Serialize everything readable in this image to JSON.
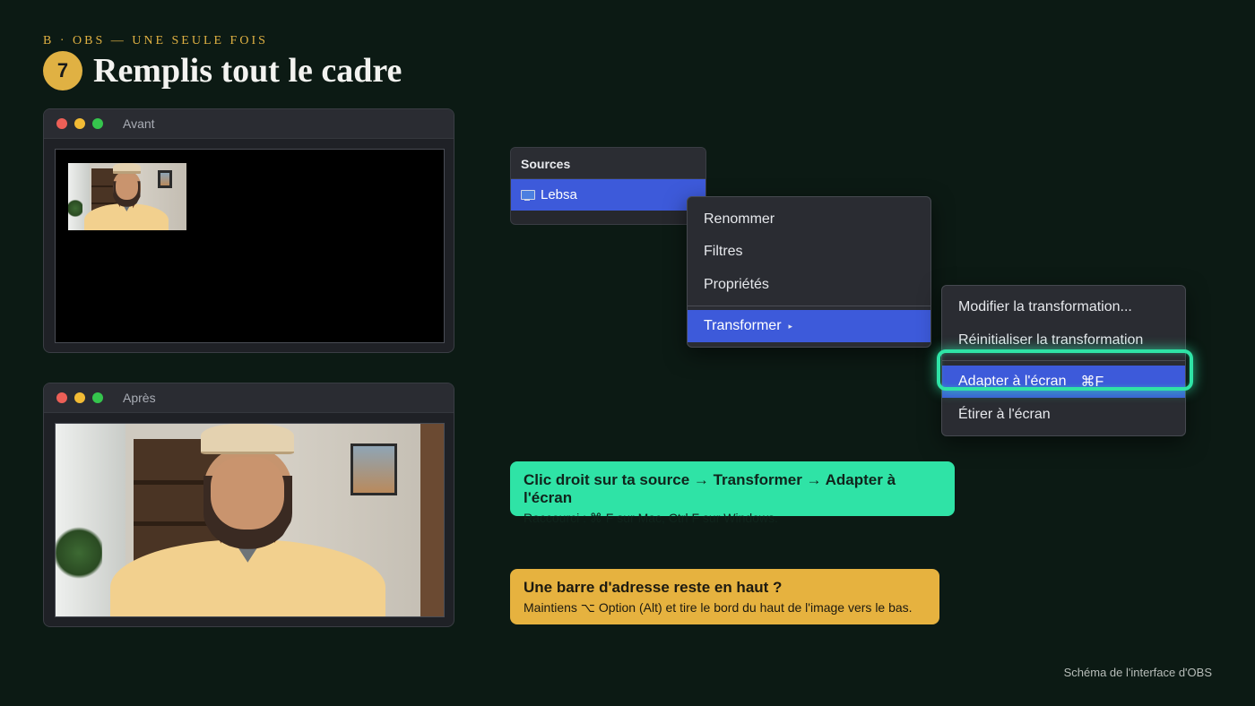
{
  "header": {
    "eyebrow": "B · OBS — UNE SEULE FOIS",
    "step_number": "7",
    "title": "Remplis tout le cadre"
  },
  "windows": {
    "before": {
      "title": "Avant"
    },
    "after": {
      "title": "Après"
    }
  },
  "sources_panel": {
    "heading": "Sources",
    "selected_source": "Lebsa",
    "source_icon": "monitor-icon"
  },
  "context_menu": {
    "items": [
      "Renommer",
      "Filtres",
      "Propriétés",
      "Transformer"
    ],
    "active": "Transformer"
  },
  "transform_submenu": {
    "items": [
      "Modifier la transformation...",
      "Réinitialiser la transformation",
      "Adapter à l'écran",
      "Étirer à l'écran"
    ],
    "active": "Adapter à l'écran",
    "active_shortcut": "⌘F"
  },
  "callouts": {
    "primary": {
      "title": "Clic droit sur ta source → Transformer → Adapter à l'écran",
      "subtitle": "Raccourci : ⌘ F sur Mac, Ctrl F sur Windows."
    },
    "tip": {
      "title": "Une barre d'adresse reste en haut ?",
      "subtitle": "Maintiens ⌥ Option (Alt) et tire le bord du haut de l'image vers le bas."
    }
  },
  "caption": "Schéma de l'interface d'OBS",
  "colors": {
    "background": "#0c1a14",
    "accent_gold": "#e0b143",
    "selection_blue": "#3d5ada",
    "highlight_green": "#2fe3a6"
  }
}
